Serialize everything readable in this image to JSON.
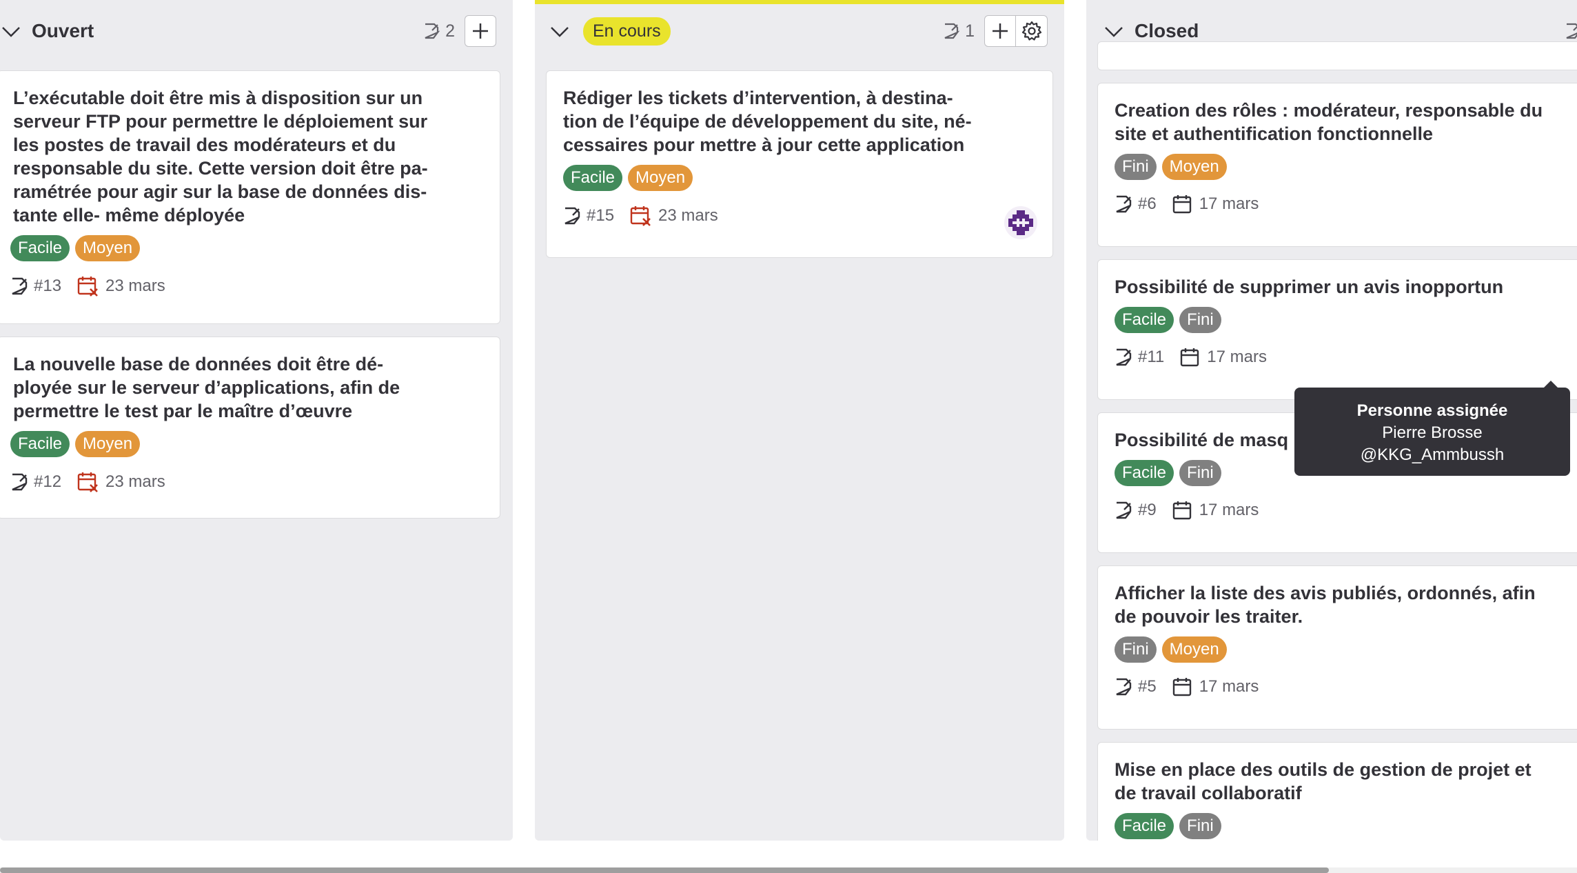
{
  "columns": [
    {
      "title": "Ouvert",
      "count": "2",
      "cards": [
        {
          "title": "L’exécutable doit être mis à disposition sur un\nserveur FTP pour permettre le déploiement sur\nles postes de travail des modérateurs et du\nresponsable du site. Cette version doit être pa-\nramétrée pour agir sur la base de données dis-\ntante elle- même déployée",
          "labels": [
            "Facile",
            "Moyen"
          ],
          "issue": "#13",
          "date": "23 mars"
        },
        {
          "title": "La nouvelle base de données doit être dé-\nployée sur le serveur d’applications, afin de\npermettre le test par le maître d’œuvre",
          "labels": [
            "Facile",
            "Moyen"
          ],
          "issue": "#12",
          "date": "23 mars"
        }
      ]
    },
    {
      "title": "En cours",
      "count": "1",
      "cards": [
        {
          "title": "Rédiger les tickets d’intervention, à destina-\ntion de l’équipe de développement du site, né-\ncessaires pour mettre à jour cette application",
          "labels": [
            "Facile",
            "Moyen"
          ],
          "issue": "#15",
          "date": "23 mars"
        }
      ]
    },
    {
      "title": "Closed",
      "cards": [
        {
          "title": "Creation des rôles : modérateur, responsable du\nsite et authentification fonctionnelle",
          "labels": [
            "Fini",
            "Moyen"
          ],
          "issue": "#6",
          "date": "17 mars"
        },
        {
          "title": "Possibilité de supprimer un avis inopportun",
          "labels": [
            "Facile",
            "Fini"
          ],
          "issue": "#11",
          "date": "17 mars"
        },
        {
          "title": "Possibilité de masq",
          "labels": [
            "Facile",
            "Fini"
          ],
          "issue": "#9",
          "date": "17 mars"
        },
        {
          "title": "Afficher la liste des avis publiés, ordonnés, afin\nde pouvoir les traiter.",
          "labels": [
            "Fini",
            "Moyen"
          ],
          "issue": "#5",
          "date": "17 mars"
        },
        {
          "title": "Mise en place des outils de gestion de projet et\nde travail collaboratif",
          "labels": [
            "Facile",
            "Fini"
          ]
        }
      ]
    }
  ],
  "tooltip": {
    "heading": "Personne assignée",
    "name": "Pierre Brosse",
    "username": "@KKG_Ammbussh"
  },
  "colors": {
    "label_green": "#428a5a",
    "label_orange": "#e2963a",
    "label_gray": "#808080",
    "in_progress_yellow": "#e9e32c",
    "overdue_red": "#c0341d"
  }
}
